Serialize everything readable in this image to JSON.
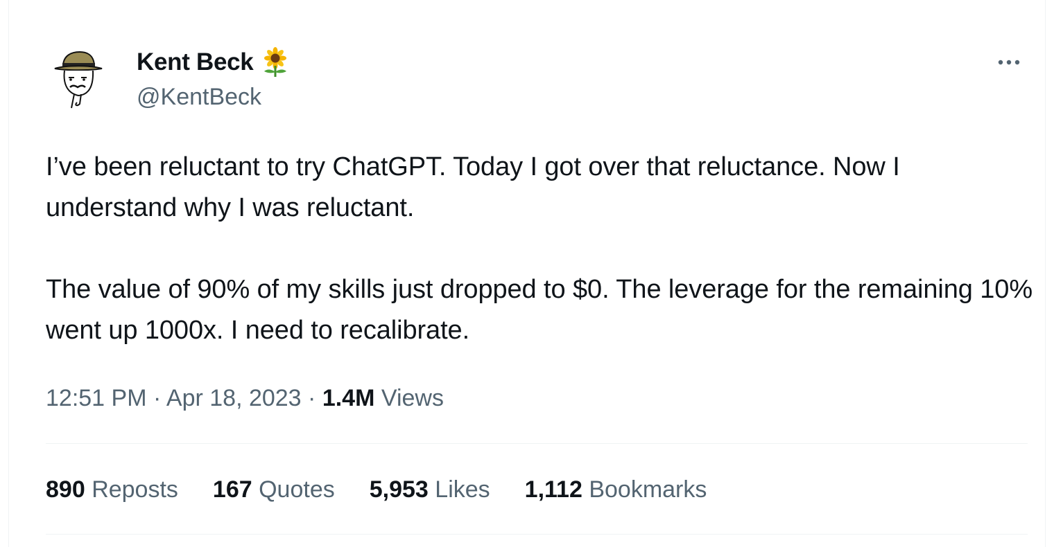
{
  "author": {
    "display_name": "Kent Beck",
    "handle": "@KentBeck",
    "badge_icon": "sunflower-icon",
    "avatar_icon": "hat-avatar-icon"
  },
  "tweet": {
    "paragraphs": [
      "I’ve been reluctant to try ChatGPT. Today I got over that reluctance. Now I understand why I was reluctant.",
      "The value of 90% of my skills just dropped to $0. The leverage for the remaining 10% went up 1000x. I need to recalibrate."
    ]
  },
  "meta": {
    "time": "12:51 PM",
    "separator": "·",
    "date": "Apr 18, 2023",
    "views_count": "1.4M",
    "views_label": "Views"
  },
  "stats": [
    {
      "count": "890",
      "label": "Reposts"
    },
    {
      "count": "167",
      "label": "Quotes"
    },
    {
      "count": "5,953",
      "label": "Likes"
    },
    {
      "count": "1,112",
      "label": "Bookmarks"
    }
  ],
  "menu": {
    "icon": "more-options-icon"
  },
  "colors": {
    "text_primary": "#0f1419",
    "text_secondary": "#536471",
    "divider": "#eff3f4",
    "avatar_hat": "#9a8c55"
  }
}
